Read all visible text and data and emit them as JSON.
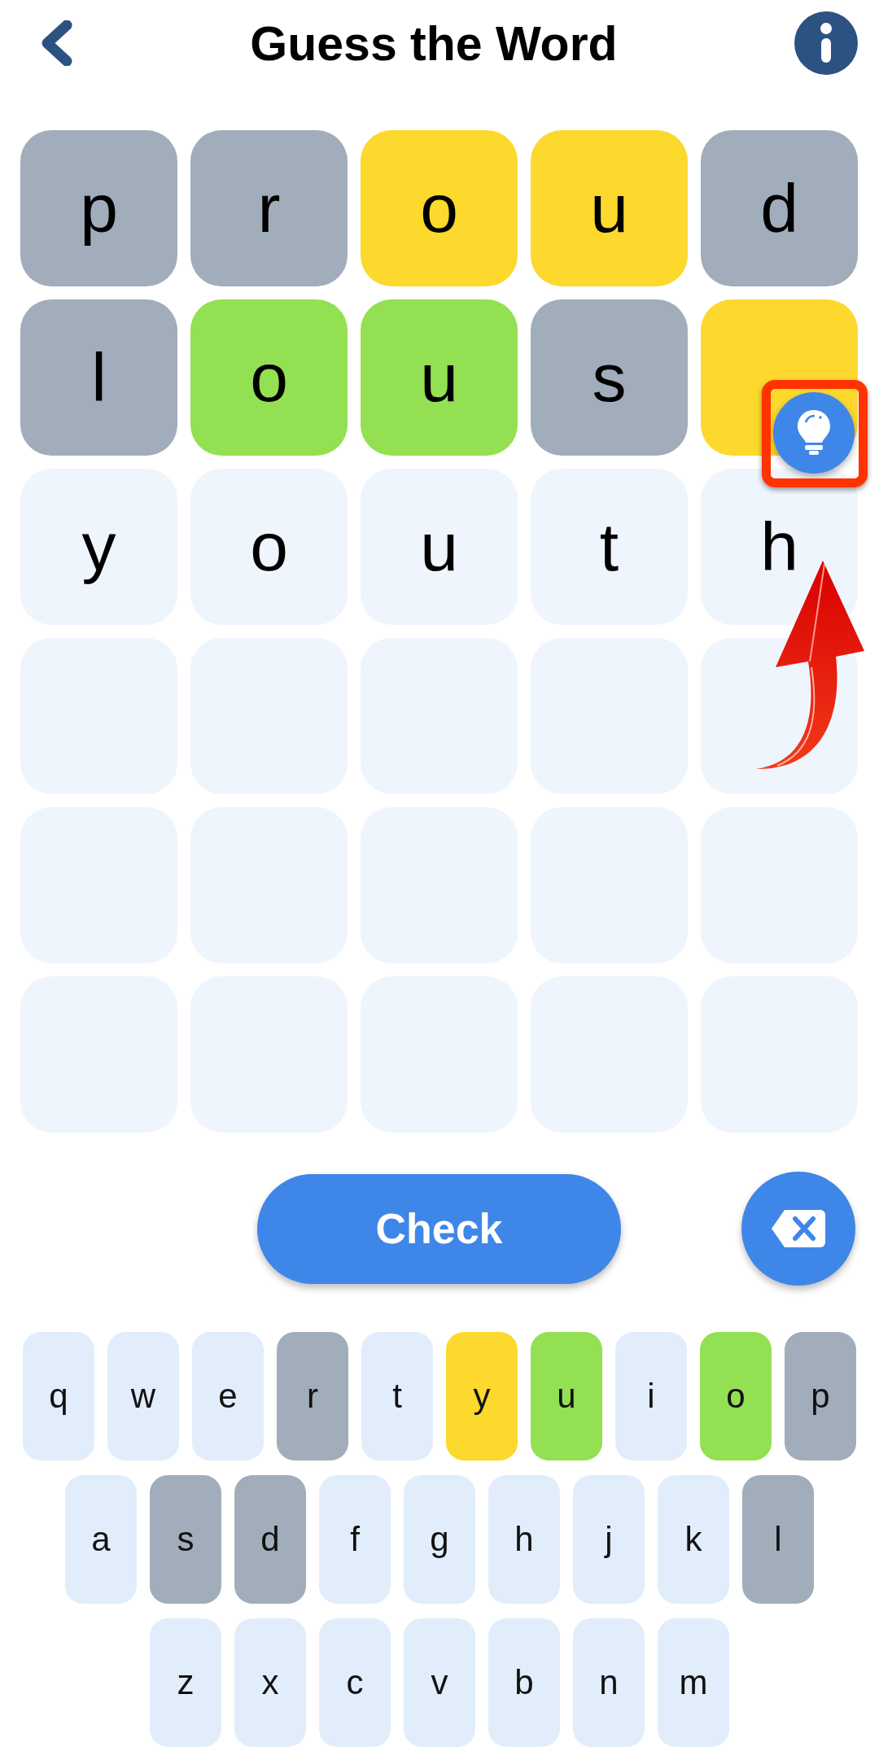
{
  "header": {
    "title": "Guess the Word"
  },
  "board": {
    "rows": [
      [
        {
          "letter": "p",
          "color": "#a1adba"
        },
        {
          "letter": "r",
          "color": "#a1adba"
        },
        {
          "letter": "o",
          "color": "#fdd82d"
        },
        {
          "letter": "u",
          "color": "#fdd82d"
        },
        {
          "letter": "d",
          "color": "#a1adba"
        }
      ],
      [
        {
          "letter": "l",
          "color": "#a1adba"
        },
        {
          "letter": "o",
          "color": "#93e052"
        },
        {
          "letter": "u",
          "color": "#93e052"
        },
        {
          "letter": "s",
          "color": "#a1adba"
        },
        {
          "color": "#fdd82d"
        }
      ],
      [
        {
          "letter": "y",
          "color": "#eef5fd"
        },
        {
          "letter": "o",
          "color": "#eef5fd"
        },
        {
          "letter": "u",
          "color": "#eef5fd"
        },
        {
          "letter": "t",
          "color": "#eef5fd"
        },
        {
          "letter": "h",
          "color": "#eef5fd"
        }
      ],
      [
        {
          "color": "#eef5fd"
        },
        {
          "color": "#eef5fd"
        },
        {
          "color": "#eef5fd"
        },
        {
          "color": "#eef5fd"
        },
        {
          "color": "#eef5fd"
        }
      ],
      [
        {
          "color": "#eef5fd"
        },
        {
          "color": "#eef5fd"
        },
        {
          "color": "#eef5fd"
        },
        {
          "color": "#eef5fd"
        },
        {
          "color": "#eef5fd"
        }
      ],
      [
        {
          "color": "#eef5fd"
        },
        {
          "color": "#eef5fd"
        },
        {
          "color": "#eef5fd"
        },
        {
          "color": "#eef5fd"
        },
        {
          "color": "#eef5fd"
        }
      ]
    ]
  },
  "actions": {
    "check_label": "Check"
  },
  "keyboard": {
    "rows": [
      [
        {
          "key": "q",
          "color": "#e1edfb"
        },
        {
          "key": "w",
          "color": "#e1edfb"
        },
        {
          "key": "e",
          "color": "#e1edfb"
        },
        {
          "key": "r",
          "color": "#a1adba"
        },
        {
          "key": "t",
          "color": "#e1edfb"
        },
        {
          "key": "y",
          "color": "#fdd82d"
        },
        {
          "key": "u",
          "color": "#93e052"
        },
        {
          "key": "i",
          "color": "#e1edfb"
        },
        {
          "key": "o",
          "color": "#93e052"
        },
        {
          "key": "p",
          "color": "#a1adba"
        }
      ],
      [
        {
          "key": "a",
          "color": "#e1edfb"
        },
        {
          "key": "s",
          "color": "#a1adba"
        },
        {
          "key": "d",
          "color": "#a1adba"
        },
        {
          "key": "f",
          "color": "#e1edfb"
        },
        {
          "key": "g",
          "color": "#e1edfb"
        },
        {
          "key": "h",
          "color": "#e1edfb"
        },
        {
          "key": "j",
          "color": "#e1edfb"
        },
        {
          "key": "k",
          "color": "#e1edfb"
        },
        {
          "key": "l",
          "color": "#a1adba"
        }
      ],
      [
        {
          "key": "z",
          "color": "#e1edfb"
        },
        {
          "key": "x",
          "color": "#e1edfb"
        },
        {
          "key": "c",
          "color": "#e1edfb"
        },
        {
          "key": "v",
          "color": "#e1edfb"
        },
        {
          "key": "b",
          "color": "#e1edfb"
        },
        {
          "key": "n",
          "color": "#e1edfb"
        },
        {
          "key": "m",
          "color": "#e1edfb"
        }
      ]
    ]
  }
}
